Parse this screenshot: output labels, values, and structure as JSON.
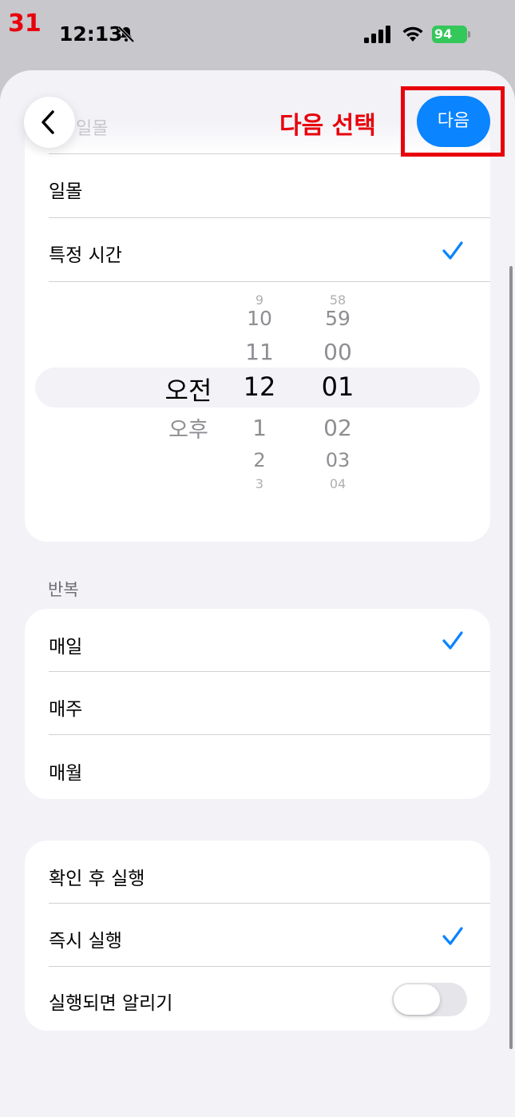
{
  "status_bar": {
    "step_number": "31",
    "time": "12:13",
    "battery_level": "94"
  },
  "header": {
    "annotation": "다음 선택",
    "next_label": "다음"
  },
  "time_options": {
    "items": [
      {
        "label": "일몰",
        "selected": false
      },
      {
        "label": "특정 시간",
        "selected": true
      }
    ]
  },
  "picker": {
    "ampm": {
      "options": [
        "오전",
        "오후"
      ],
      "selected": "오전"
    },
    "hours": {
      "visible": [
        "9",
        "10",
        "11",
        "12",
        "1",
        "2",
        "3"
      ],
      "selected": "12"
    },
    "minutes": {
      "visible": [
        "58",
        "59",
        "00",
        "01",
        "02",
        "03",
        "04"
      ],
      "selected": "01"
    }
  },
  "repeat": {
    "label": "반복",
    "items": [
      {
        "label": "매일",
        "selected": true
      },
      {
        "label": "매주",
        "selected": false
      },
      {
        "label": "매월",
        "selected": false
      }
    ]
  },
  "run_mode": {
    "items": [
      {
        "label": "확인 후 실행",
        "selected": false
      },
      {
        "label": "즉시 실행",
        "selected": true
      }
    ],
    "notify_label": "실행되면 알리기",
    "notify_on": false
  },
  "colors": {
    "accent": "#0a84ff",
    "annotation_red": "#e8000b",
    "background": "#f2f2f7"
  }
}
